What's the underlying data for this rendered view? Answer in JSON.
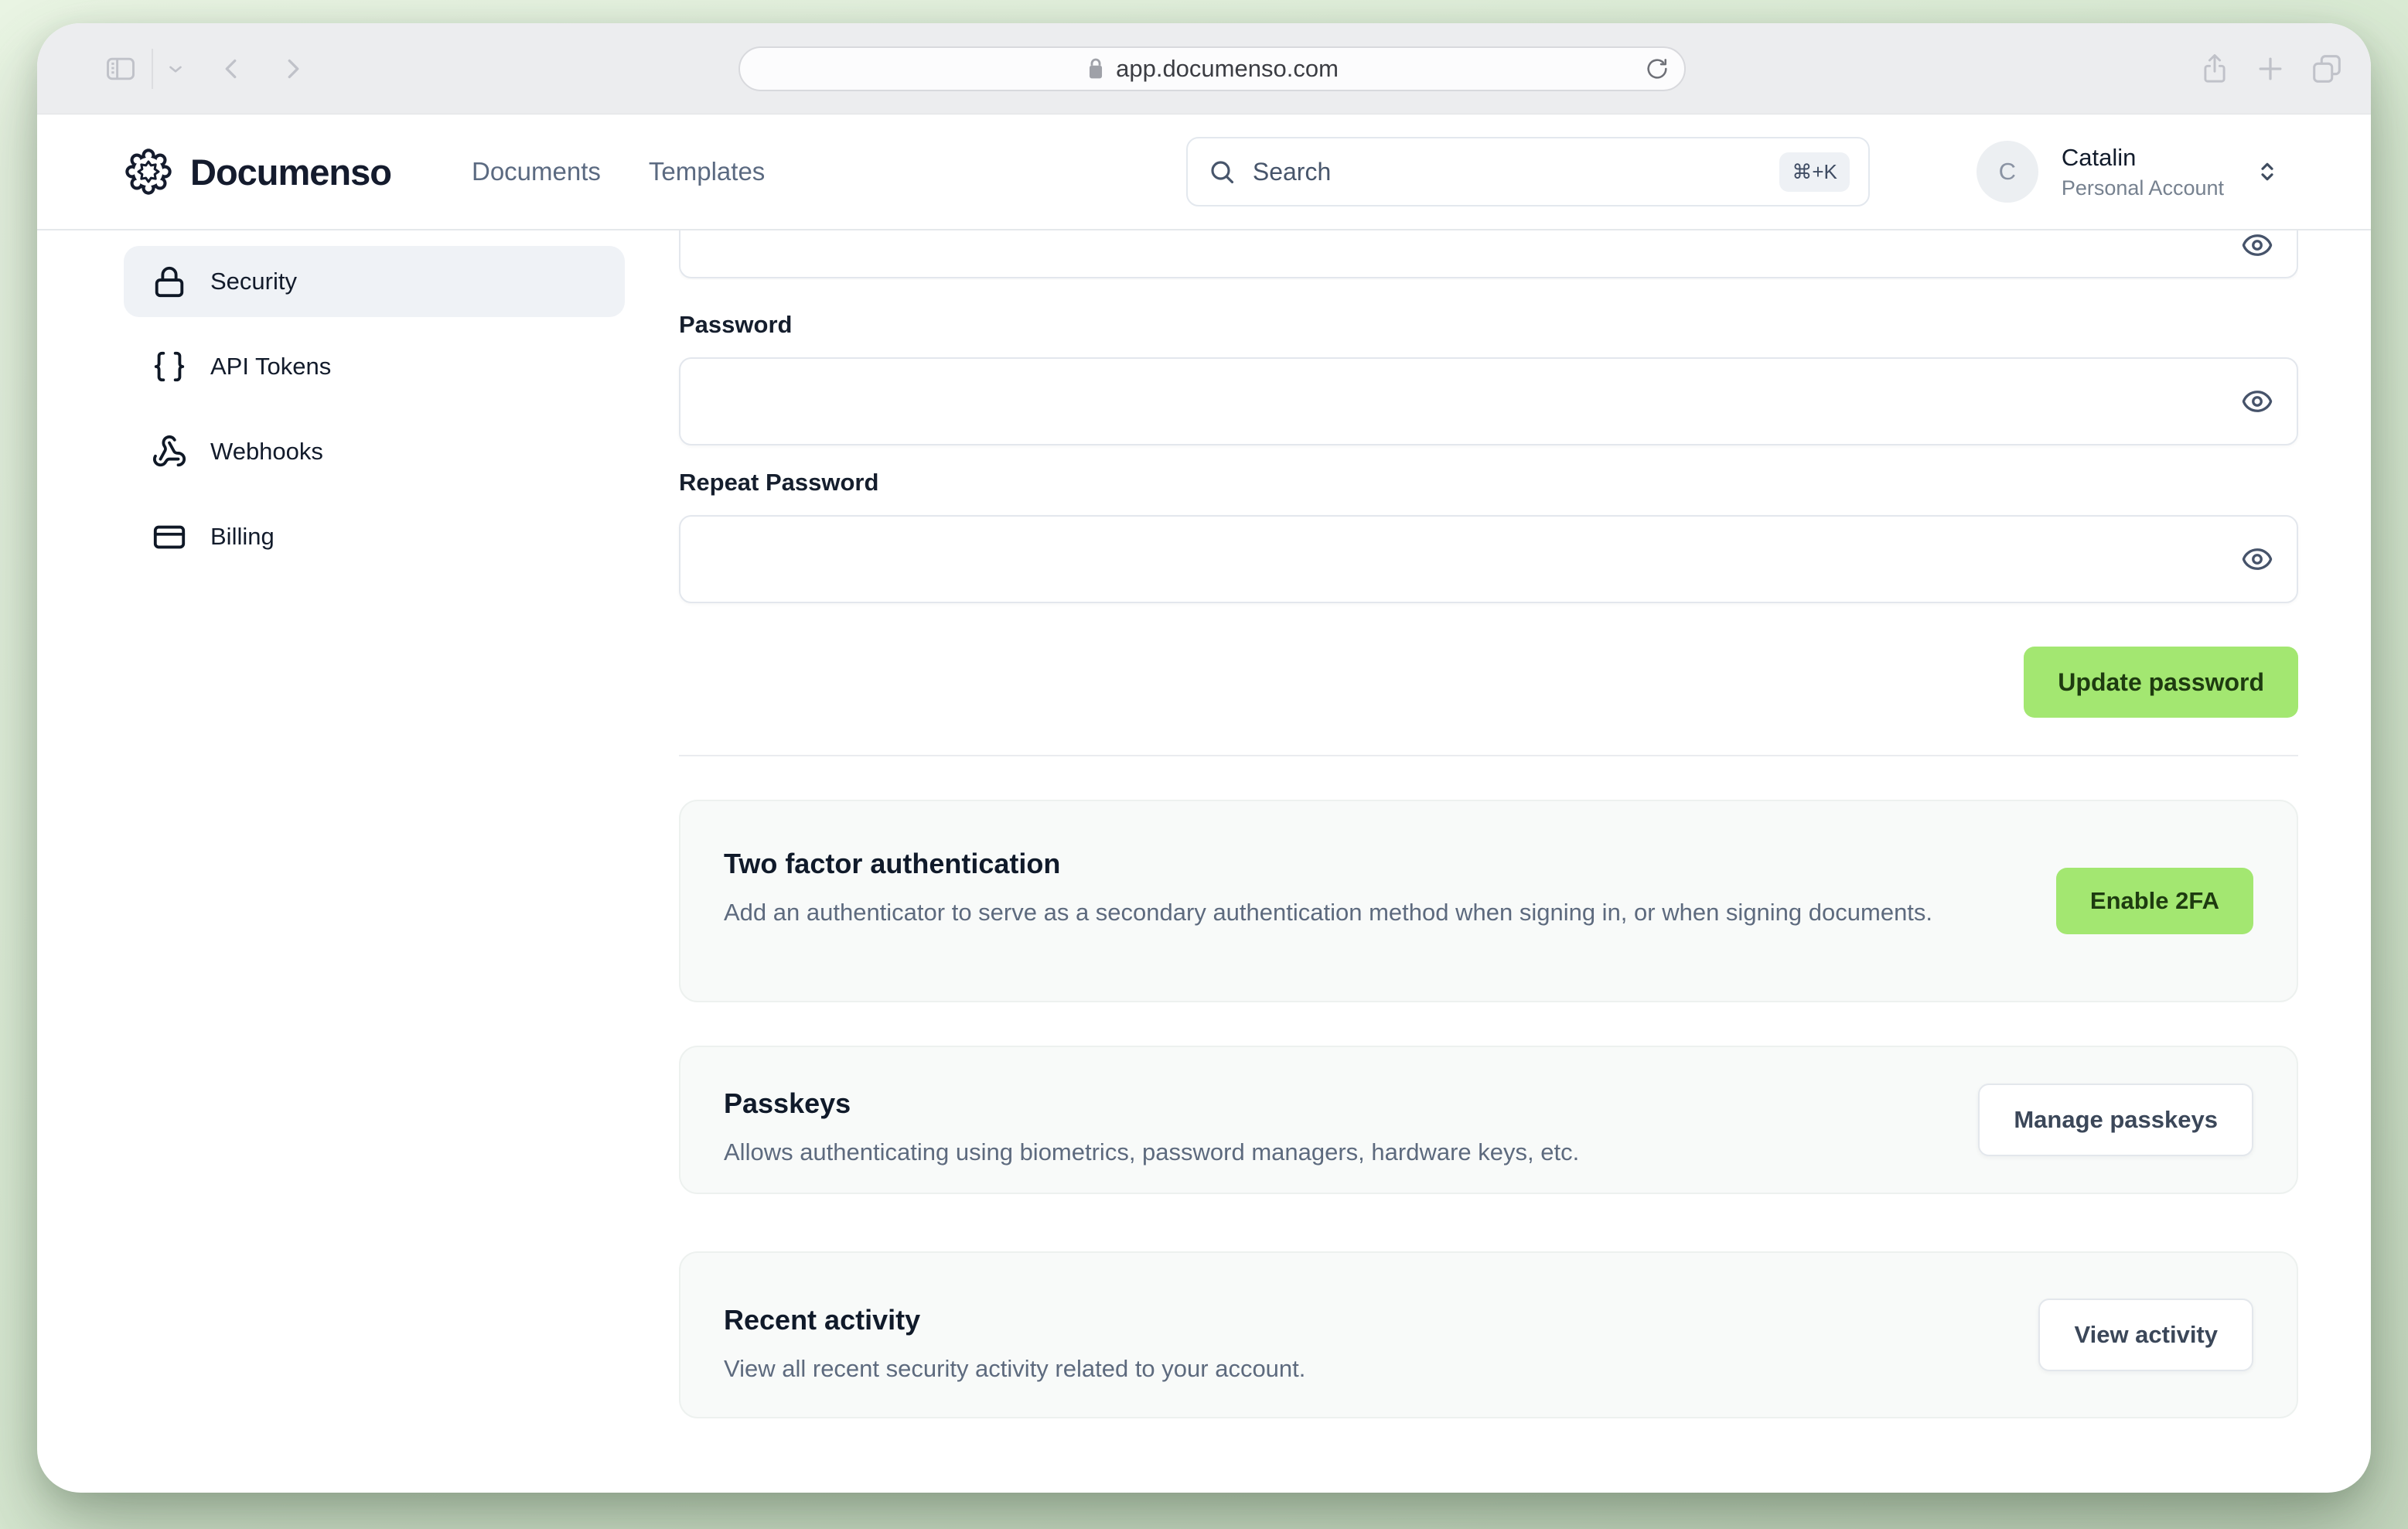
{
  "browser": {
    "url": "app.documenso.com"
  },
  "header": {
    "brand": "Documenso",
    "nav": {
      "documents": "Documents",
      "templates": "Templates"
    },
    "search": {
      "placeholder": "Search",
      "shortcut": "⌘+K"
    },
    "account": {
      "initial": "C",
      "name": "Catalin",
      "type": "Personal Account"
    }
  },
  "sidebar": {
    "items": [
      {
        "label": "Security",
        "icon": "lock-icon",
        "active": true
      },
      {
        "label": "API Tokens",
        "icon": "braces-icon",
        "active": false
      },
      {
        "label": "Webhooks",
        "icon": "webhook-icon",
        "active": false
      },
      {
        "label": "Billing",
        "icon": "credit-card-icon",
        "active": false
      }
    ]
  },
  "main": {
    "password_form": {
      "password_label": "Password",
      "repeat_label": "Repeat Password",
      "submit_label": "Update password"
    },
    "sections": [
      {
        "title": "Two factor authentication",
        "description": "Add an authenticator to serve as a secondary authentication method when signing in, or when signing documents.",
        "button": "Enable 2FA"
      },
      {
        "title": "Passkeys",
        "description": "Allows authenticating using biometrics, password managers, hardware keys, etc.",
        "button": "Manage passkeys"
      },
      {
        "title": "Recent activity",
        "description": "View all recent security activity related to your account.",
        "button": "View activity"
      }
    ]
  },
  "colors": {
    "accent_green": "#A3E771",
    "accent_green_text": "#1E3B10",
    "page_background": "#D8E9D2",
    "sidebar_active_bg": "#EFF2F6"
  }
}
